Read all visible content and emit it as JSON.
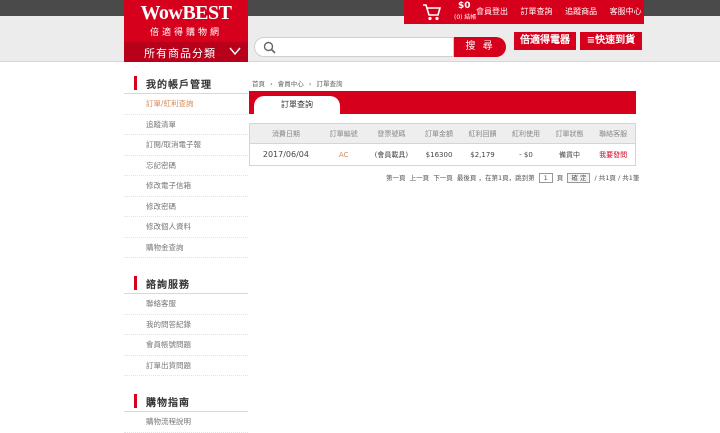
{
  "header": {
    "logo_main": "WowBEST",
    "logo_sub": "倍適得購物網",
    "category_label": "所有商品分類",
    "cart_amount": "$0",
    "cart_count": "(0) 結帳",
    "nav_links": [
      "會員登出",
      "訂單查詢",
      "追蹤商品",
      "客服中心"
    ],
    "search_placeholder": "",
    "search_button": "搜 尋",
    "promo_1": "倍適得電器",
    "promo_2": "≡快速到貨",
    "colors": {
      "brand_red": "#d7001c",
      "topbar": "#4a4a4a"
    }
  },
  "sidebar": {
    "sections": [
      {
        "title": "我的帳戶管理",
        "items": [
          "訂單/紅利查詢",
          "追蹤清單",
          "訂閱/取消電子報",
          "忘記密碼",
          "修改電子信箱",
          "修改密碼",
          "修改個人資料",
          "購物金查詢"
        ]
      },
      {
        "title": "諮詢服務",
        "items": [
          "聯絡客服",
          "我的問答紀錄",
          "會員帳號問題",
          "訂單出貨問題"
        ]
      },
      {
        "title": "購物指南",
        "items": [
          "購物流程說明"
        ]
      }
    ],
    "active_item": "訂單/紅利查詢"
  },
  "breadcrumb": [
    "首頁",
    "›",
    "會員中心",
    "›",
    "訂單查詢"
  ],
  "tab": {
    "label": "訂單查詢"
  },
  "orders": {
    "columns": [
      "消費日期",
      "訂單編號",
      "發票號碼",
      "訂單金額",
      "紅利回饋",
      "紅利使用",
      "訂單狀態",
      "聯絡客服"
    ],
    "rows": [
      {
        "date": "2017/06/04",
        "order_no": "AC",
        "invoice": "(會員載具)",
        "amount": "$16300",
        "bonus": "$2,179",
        "bonus_used": "- $0",
        "status": "備貨中",
        "contact": "我要發問"
      }
    ]
  },
  "pager": {
    "first": "第一頁",
    "prev": "上一頁",
    "next": "下一頁",
    "last": "最後頁",
    "current_label": "，在第1頁，跳到第",
    "jump_value": "1",
    "page_unit": "頁",
    "confirm": "確 定",
    "total": "/ 共1頁 / 共1筆"
  }
}
